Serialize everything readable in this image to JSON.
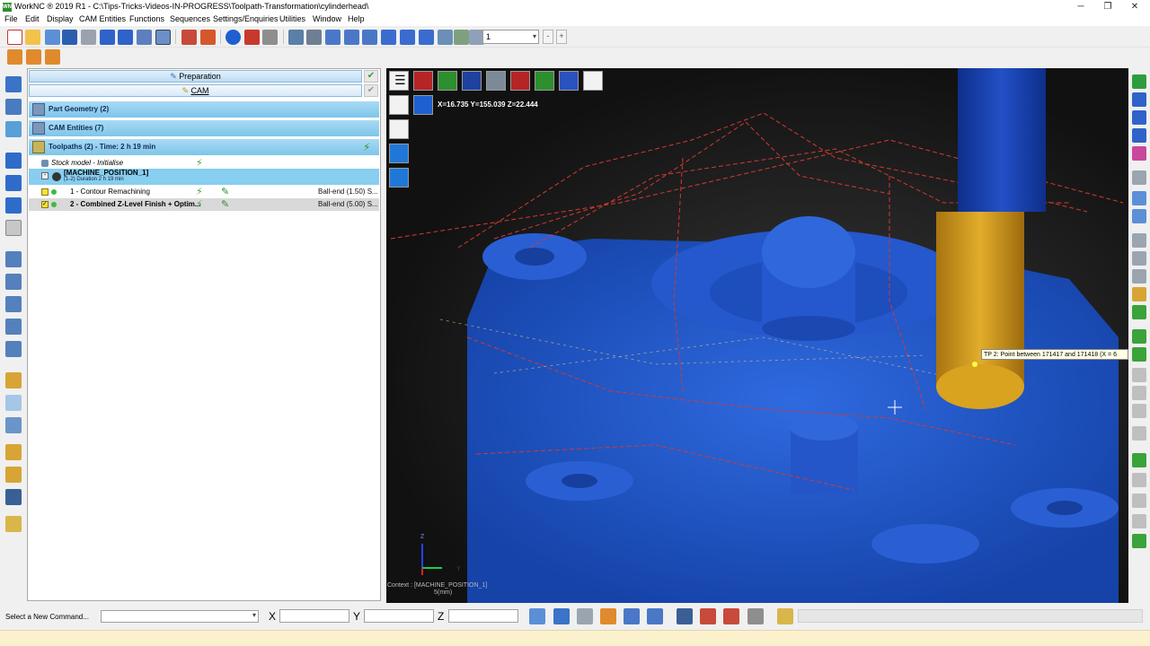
{
  "window": {
    "title": "WorkNC ® 2019 R1 - C:\\Tips-Tricks-Videos-IN-PROGRESS\\Toolpath-Transformation\\cylinderhead\\",
    "app_icon": "WNC",
    "controls": [
      "minimize-icon",
      "restore-icon",
      "close-icon"
    ]
  },
  "menubar": [
    "File",
    "Edit",
    "Display",
    "CAM Entities",
    "Functions",
    "Sequences",
    "Settings/Enquiries",
    "Utilities",
    "Window",
    "Help"
  ],
  "toolbar": {
    "level_value": "1",
    "icons": [
      "new-icon",
      "open-icon",
      "save-as-icon",
      "save-icon",
      "print-icon",
      "undo-icon",
      "redo-icon",
      "grid-icon",
      "panel-icon",
      "workzone-icon",
      "axis-icon",
      "sphere-icon",
      "cube-icon",
      "camera-icon",
      "layers-icon",
      "window-icon",
      "zoom-icon",
      "zoom-out-icon",
      "pan-icon",
      "rotate-icon",
      "dynamic-icon",
      "refresh-icon",
      "select-icon",
      "filter-icon"
    ]
  },
  "toolbar2": {
    "icons": [
      "toolpath-orange-icon",
      "toolpath-orange2-icon",
      "toolpath-cursor-icon"
    ]
  },
  "tree": {
    "tabs": [
      {
        "label": "Preparation",
        "icon": "ruler-icon"
      },
      {
        "label": "CAM",
        "icon": "pencil-icon"
      }
    ],
    "groups": [
      {
        "label": "Part Geometry (2)",
        "icon": "geometry-icon"
      },
      {
        "label": "CAM Entities (7)",
        "icon": "entities-icon"
      },
      {
        "label": "Toolpaths (2) - Time: 2 h 19 min",
        "icon": "toolpaths-icon"
      }
    ],
    "stock": "Stock model - Initialise",
    "machine_position": {
      "label": "[MACHINE_POSITION_1]",
      "sub": "(1-2) Duration 2 h 19 min"
    },
    "toolpaths": [
      {
        "label": "1 - Contour Remachining",
        "tool": "Ball-end (1.50) S..."
      },
      {
        "label": "2 - Combined Z-Level Finish + Optim...",
        "tool": "Ball-end (5.00) S..."
      }
    ]
  },
  "viewport": {
    "coords": "X=16.735    Y=155.039  Z=22.444",
    "tooltip": "TP 2: Point between 171417 and 171418 (X = 6",
    "context": "Context : [MACHINE_POSITION_1]",
    "scale": "5(mm)",
    "triad": {
      "x": "X",
      "y": "Y",
      "z": "Z"
    },
    "view_buttons": [
      "menu-icon",
      "view-red-icon",
      "view-green-icon",
      "view-blue-icon",
      "view-grey-icon",
      "view-red2-icon",
      "view-green2-icon",
      "view-blue-layer-icon",
      "view-search-icon"
    ]
  },
  "commandbar": {
    "label": "Select a New Command...",
    "x_label": "X",
    "y_label": "Y",
    "z_label": "Z"
  },
  "colors": {
    "part_blue": "#1c4fc0",
    "tool_orange": "#d9a21f",
    "toolpath_red": "#c9362f",
    "tree_highlight": "#87cef0"
  }
}
